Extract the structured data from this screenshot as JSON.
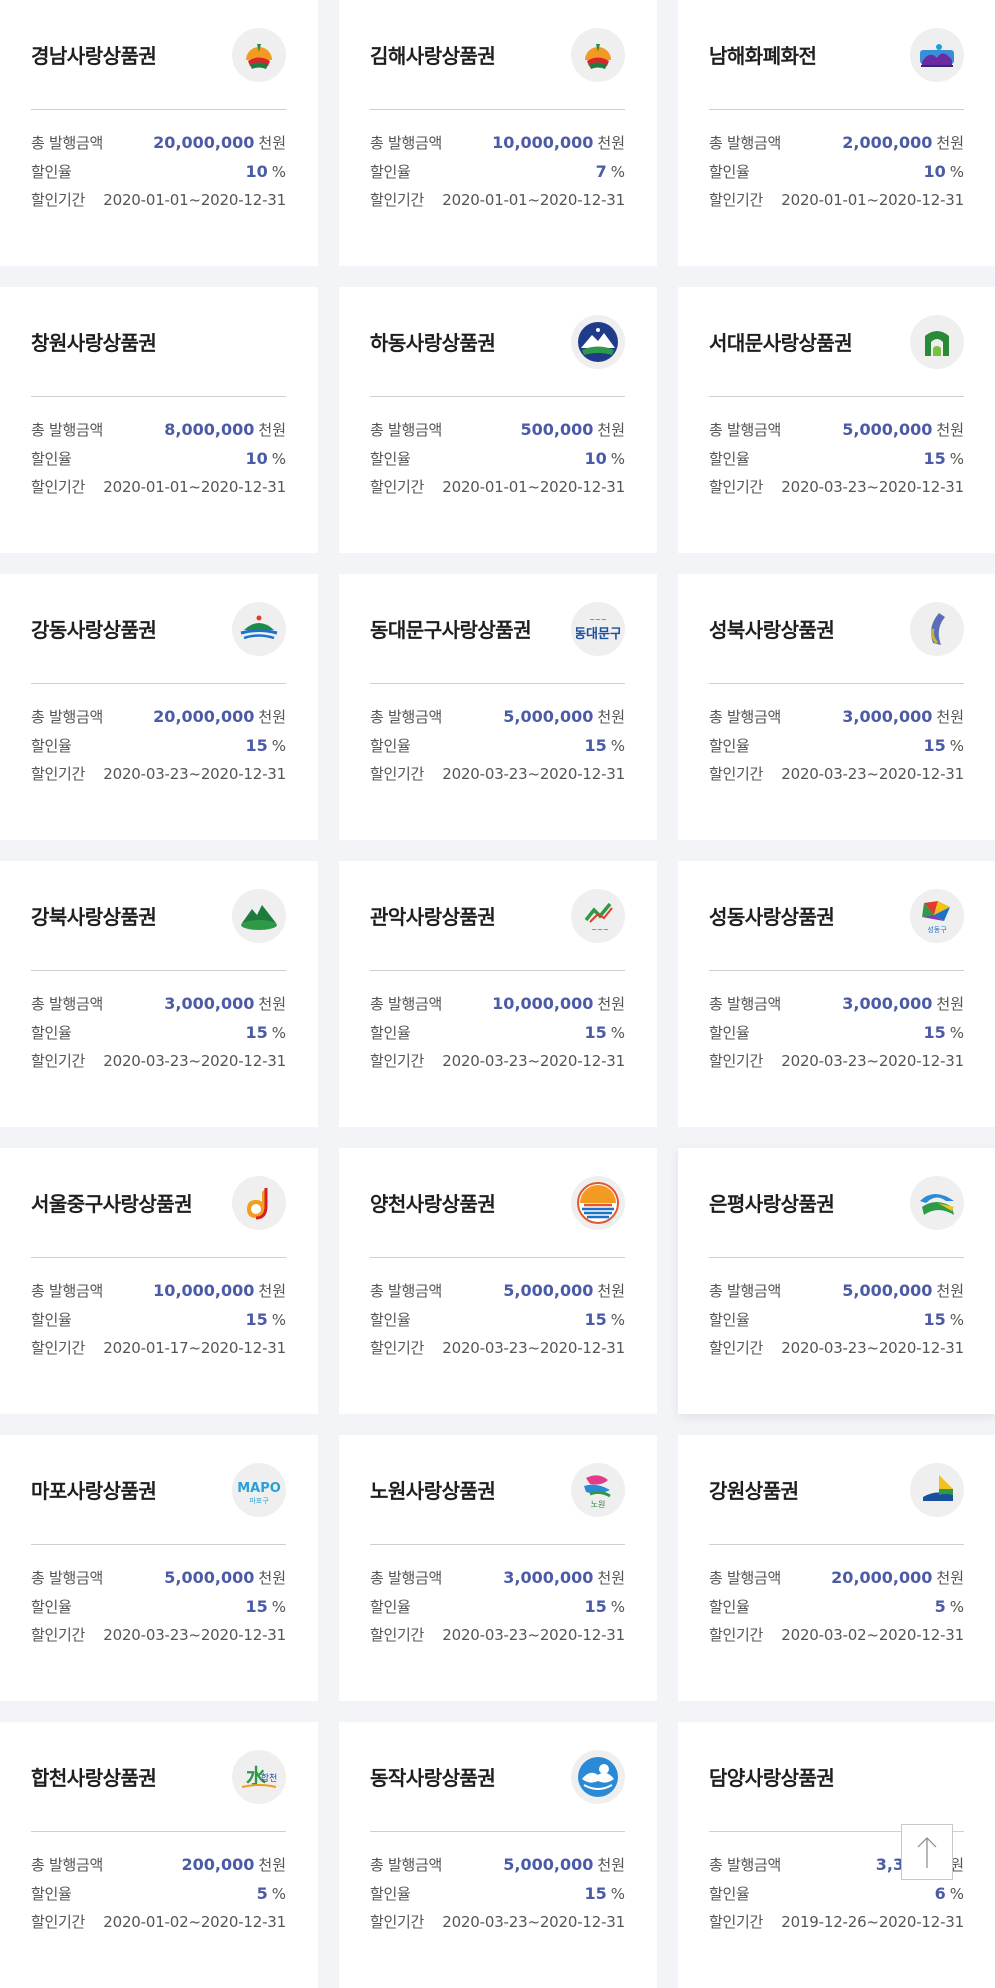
{
  "labels": {
    "amount": "총 발행금액",
    "rate": "할인율",
    "period": "할인기간"
  },
  "units": {
    "amount": "천원",
    "rate": "%"
  },
  "cards": [
    {
      "title": "경남사랑상품권",
      "amount": "20,000,000",
      "rate": "10",
      "period": "2020-01-01~2020-12-31",
      "logo": "sunrise-logo-icon"
    },
    {
      "title": "김해사랑상품권",
      "amount": "10,000,000",
      "rate": "7",
      "period": "2020-01-01~2020-12-31",
      "logo": "sunrise-logo-icon"
    },
    {
      "title": "남해화폐화전",
      "amount": "2,000,000",
      "rate": "10",
      "period": "2020-01-01~2020-12-31",
      "logo": "island-logo-icon"
    },
    {
      "title": "창원사랑상품권",
      "amount": "8,000,000",
      "rate": "10",
      "period": "2020-01-01~2020-12-31",
      "logo": ""
    },
    {
      "title": "하동사랑상품권",
      "amount": "500,000",
      "rate": "10",
      "period": "2020-01-01~2020-12-31",
      "logo": "mountain-logo-icon"
    },
    {
      "title": "서대문사랑상품권",
      "amount": "5,000,000",
      "rate": "15",
      "period": "2020-03-23~2020-12-31",
      "logo": "gate-logo-icon"
    },
    {
      "title": "강동사랑상품권",
      "amount": "20,000,000",
      "rate": "15",
      "period": "2020-03-23~2020-12-31",
      "logo": "river-logo-icon"
    },
    {
      "title": "동대문구사랑상품권",
      "amount": "5,000,000",
      "rate": "15",
      "period": "2020-03-23~2020-12-31",
      "logo": "dongdaemun-logo-icon"
    },
    {
      "title": "성북사랑상품권",
      "amount": "3,000,000",
      "rate": "15",
      "period": "2020-03-23~2020-12-31",
      "logo": "dots-logo-icon"
    },
    {
      "title": "강북사랑상품권",
      "amount": "3,000,000",
      "rate": "15",
      "period": "2020-03-23~2020-12-31",
      "logo": "green-mountain-logo-icon"
    },
    {
      "title": "관악사랑상품권",
      "amount": "10,000,000",
      "rate": "15",
      "period": "2020-03-23~2020-12-31",
      "logo": "gwanak-logo-icon"
    },
    {
      "title": "성동사랑상품권",
      "amount": "3,000,000",
      "rate": "15",
      "period": "2020-03-23~2020-12-31",
      "logo": "seongdong-logo-icon"
    },
    {
      "title": "서울중구사랑상품권",
      "amount": "10,000,000",
      "rate": "15",
      "period": "2020-01-17~2020-12-31",
      "logo": "letter-j-logo-icon"
    },
    {
      "title": "양천사랑상품권",
      "amount": "5,000,000",
      "rate": "15",
      "period": "2020-03-23~2020-12-31",
      "logo": "sun-water-logo-icon"
    },
    {
      "title": "은평사랑상품권",
      "amount": "5,000,000",
      "rate": "15",
      "period": "2020-03-23~2020-12-31",
      "logo": "eunpyeong-logo-icon"
    },
    {
      "title": "마포사랑상품권",
      "amount": "5,000,000",
      "rate": "15",
      "period": "2020-03-23~2020-12-31",
      "logo": "mapo-logo-icon"
    },
    {
      "title": "노원사랑상품권",
      "amount": "3,000,000",
      "rate": "15",
      "period": "2020-03-23~2020-12-31",
      "logo": "nowon-logo-icon"
    },
    {
      "title": "강원상품권",
      "amount": "20,000,000",
      "rate": "5",
      "period": "2020-03-02~2020-12-31",
      "logo": "gangwon-logo-icon"
    },
    {
      "title": "합천사랑상품권",
      "amount": "200,000",
      "rate": "5",
      "period": "2020-01-02~2020-12-31",
      "logo": "hapcheon-logo-icon"
    },
    {
      "title": "동작사랑상품권",
      "amount": "5,000,000",
      "rate": "15",
      "period": "2020-03-23~2020-12-31",
      "logo": "dongjak-logo-icon"
    },
    {
      "title": "담양사랑상품권",
      "amount": "3,300,",
      "rate": "6",
      "period": "2019-12-26~2020-12-31",
      "logo": ""
    }
  ],
  "logo_text": {
    "mapo": "MAPO",
    "mapo_sub": "마포구",
    "dongdaemun": "동대문구",
    "seongdong": "성동구",
    "nowon": "노원",
    "hapcheon": "합천"
  },
  "scroll_top_icon": "arrow-up-icon",
  "colors": {
    "accent": "#4b5ba5",
    "background": "#f3f4f8"
  }
}
